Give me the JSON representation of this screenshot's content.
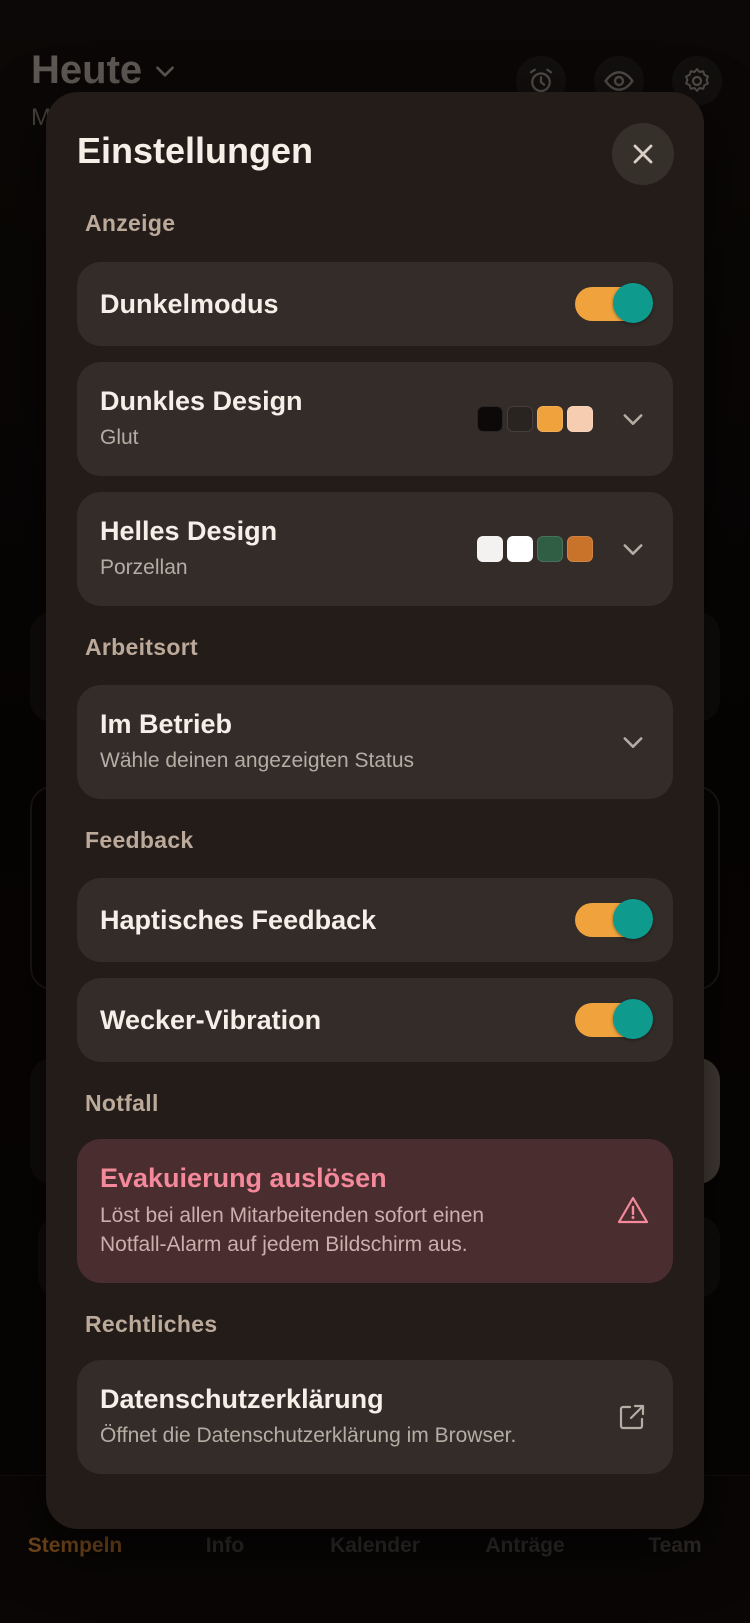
{
  "background": {
    "title": "Heute",
    "subtitle": "M",
    "header_icons": [
      "alarm-icon",
      "eye-icon",
      "gear-icon"
    ],
    "tabs": [
      {
        "label": "Stempeln",
        "icon": "clock-icon",
        "active": true
      },
      {
        "label": "Info",
        "icon": "info-icon",
        "active": false
      },
      {
        "label": "Kalender",
        "icon": "calendar-icon",
        "active": false
      },
      {
        "label": "Anträge",
        "icon": "document-icon",
        "active": false
      },
      {
        "label": "Team",
        "icon": "team-icon",
        "active": false
      }
    ]
  },
  "settings": {
    "title": "Einstellungen",
    "close_icon": "close-icon",
    "sections": {
      "display": "Anzeige",
      "workplace": "Arbeitsort",
      "feedback": "Feedback",
      "emergency": "Notfall",
      "legal": "Rechtliches"
    },
    "dark_mode": {
      "label": "Dunkelmodus",
      "enabled": true
    },
    "dark_design": {
      "label": "Dunkles Design",
      "value": "Glut",
      "swatches": [
        "#0c0908",
        "#2a2421",
        "#f0a23c",
        "#f6cdb0"
      ]
    },
    "light_design": {
      "label": "Helles Design",
      "value": "Porzellan",
      "swatches": [
        "#f4f2f0",
        "#ffffff",
        "#2f5e45",
        "#c9732a"
      ]
    },
    "workplace": {
      "label": "Im Betrieb",
      "hint": "Wähle deinen angezeigten Status"
    },
    "haptic": {
      "label": "Haptisches Feedback",
      "enabled": true
    },
    "alarm_vibration": {
      "label": "Wecker-Vibration",
      "enabled": true
    },
    "evacuation": {
      "label": "Evakuierung auslösen",
      "description_line1": "Löst bei allen Mitarbeitenden sofort einen",
      "description_line2": "Notfall-Alarm auf jedem Bildschirm aus.",
      "icon": "warning-icon"
    },
    "privacy": {
      "label": "Datenschutzerklärung",
      "hint": "Öffnet die Datenschutzerklärung im Browser.",
      "icon": "external-link-icon"
    },
    "colors": {
      "accent": "#f0a23c",
      "toggle_knob": "#0e9a8c",
      "danger": "#f3899a"
    }
  }
}
